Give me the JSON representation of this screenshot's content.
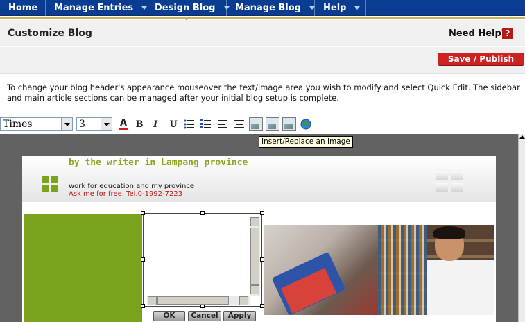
{
  "nav": {
    "items": [
      {
        "label": "Home",
        "has_menu": false
      },
      {
        "label": "Manage Entries",
        "has_menu": true
      },
      {
        "label": "Design Blog",
        "has_menu": true
      },
      {
        "label": "Manage Blog",
        "has_menu": true
      },
      {
        "label": "Help",
        "has_menu": true
      }
    ],
    "active": "Design Blog",
    "colors": {
      "bar": "#0a3d91",
      "accent": "#c9b25a"
    }
  },
  "header": {
    "title": "Customize Blog",
    "help_label": "Need Help?",
    "help_icon": "help-icon"
  },
  "actions": {
    "save_label": "Save / Publish",
    "save_color": "#cc2222"
  },
  "instructions": "To change your blog header's appearance mouseover the text/image area you wish to modify and select Quick Edit. The sidebar and main article sections can be managed after your initial blog setup is complete.",
  "toolbar": {
    "font_family": "Times",
    "font_size": "3",
    "buttons": [
      "font-color-icon",
      "bold-icon",
      "italic-icon",
      "underline-icon",
      "bullet-list-icon",
      "numbered-list-icon",
      "align-left-icon",
      "align-center-icon",
      "insert-image-icon",
      "edit-image-icon",
      "image-properties-icon",
      "insert-link-icon"
    ],
    "bold": "B",
    "italic": "I",
    "underline": "U",
    "tooltip": "Insert/Replace an Image"
  },
  "blog": {
    "title": "by the writer in Lampang province",
    "tagline": "work for education and my province",
    "contact": "Ask me for free. Tel.0-1992-7223",
    "accent_color": "#7ba21d"
  },
  "image_editor": {
    "ok_label": "OK",
    "cancel_label": "Cancel",
    "apply_label": "Apply"
  }
}
